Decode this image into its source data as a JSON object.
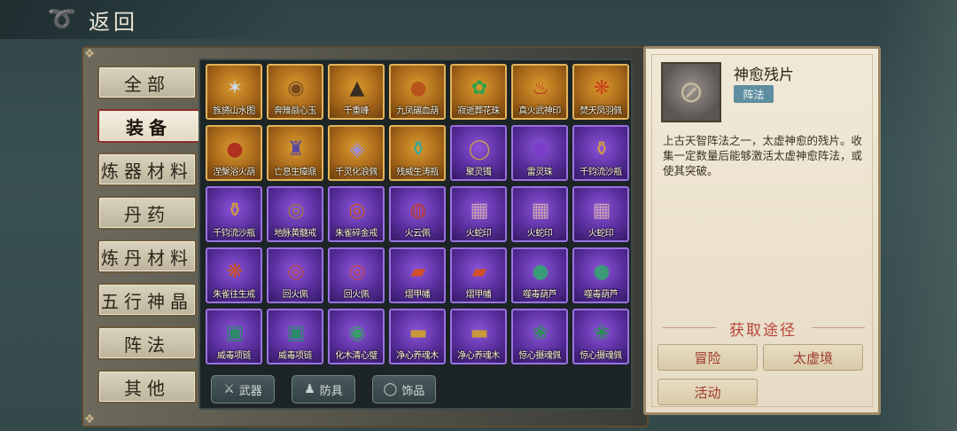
{
  "header": {
    "back_label": "返回"
  },
  "categories": [
    {
      "label": "全部",
      "active": false
    },
    {
      "label": "装备",
      "active": true
    },
    {
      "label": "炼器材料",
      "active": false
    },
    {
      "label": "丹药",
      "active": false
    },
    {
      "label": "炼丹材料",
      "active": false
    },
    {
      "label": "五行神晶",
      "active": false
    },
    {
      "label": "阵法",
      "active": false
    },
    {
      "label": "其他",
      "active": false
    }
  ],
  "items": [
    {
      "name": "旌旖山水图",
      "rarity": "gold",
      "glyph": "✶",
      "color": "#cfd8e4"
    },
    {
      "name": "奔雉赑心玉",
      "rarity": "gold",
      "glyph": "◉",
      "color": "#7a4a1e"
    },
    {
      "name": "千重峰",
      "rarity": "gold",
      "glyph": "▲",
      "color": "#3a2e22"
    },
    {
      "name": "九凤碾血葫",
      "rarity": "gold",
      "glyph": "●",
      "color": "#b8541c"
    },
    {
      "name": "寂逝葬花珠",
      "rarity": "gold",
      "glyph": "✿",
      "color": "#2fa04a"
    },
    {
      "name": "真火武神印",
      "rarity": "gold",
      "glyph": "♨",
      "color": "#b52a1e"
    },
    {
      "name": "焚天凤羽佩",
      "rarity": "gold",
      "glyph": "❋",
      "color": "#c9421c"
    },
    {
      "name": "涅槃浴火葫",
      "rarity": "gold",
      "glyph": "●",
      "color": "#b0301e"
    },
    {
      "name": "亡息生瘴鼎",
      "rarity": "gold",
      "glyph": "♜",
      "color": "#5a4aa0"
    },
    {
      "name": "千灵化浪佩",
      "rarity": "gold",
      "glyph": "◈",
      "color": "#9d8ed6"
    },
    {
      "name": "残威生涛瓶",
      "rarity": "gold",
      "glyph": "⚱",
      "color": "#2ea6a0"
    },
    {
      "name": "聚灵镯",
      "rarity": "purple",
      "glyph": "◯",
      "color": "#c8a04a"
    },
    {
      "name": "雷灵珠",
      "rarity": "purple",
      "glyph": "●",
      "color": "#7a3ec8"
    },
    {
      "name": "千钧流沙瓶",
      "rarity": "purple",
      "glyph": "⚱",
      "color": "#d4a03a"
    },
    {
      "name": "千钧流沙瓶",
      "rarity": "purple",
      "glyph": "⚱",
      "color": "#d4a03a"
    },
    {
      "name": "地脉黄髓戒",
      "rarity": "purple",
      "glyph": "◎",
      "color": "#a07a3a"
    },
    {
      "name": "朱雀碎金戒",
      "rarity": "purple",
      "glyph": "◎",
      "color": "#c85a1e"
    },
    {
      "name": "火云佩",
      "rarity": "purple",
      "glyph": "◍",
      "color": "#b83a2a"
    },
    {
      "name": "火蛇印",
      "rarity": "purple",
      "glyph": "▦",
      "color": "#c8a0b4"
    },
    {
      "name": "火蛇印",
      "rarity": "purple",
      "glyph": "▦",
      "color": "#c8a0b4"
    },
    {
      "name": "火蛇印",
      "rarity": "purple",
      "glyph": "▦",
      "color": "#c8a0b4"
    },
    {
      "name": "朱雀往生戒",
      "rarity": "purple",
      "glyph": "❋",
      "color": "#c8501e"
    },
    {
      "name": "回火佩",
      "rarity": "purple",
      "glyph": "◎",
      "color": "#c04848"
    },
    {
      "name": "回火佩",
      "rarity": "purple",
      "glyph": "◎",
      "color": "#c04848"
    },
    {
      "name": "熠甲幡",
      "rarity": "purple",
      "glyph": "▰",
      "color": "#d0502a"
    },
    {
      "name": "熠甲幡",
      "rarity": "purple",
      "glyph": "▰",
      "color": "#d0502a"
    },
    {
      "name": "噬毒葫芦",
      "rarity": "purple",
      "glyph": "●",
      "color": "#3a9a7a"
    },
    {
      "name": "噬毒葫芦",
      "rarity": "purple",
      "glyph": "●",
      "color": "#3a9a7a"
    },
    {
      "name": "威毒项链",
      "rarity": "purple",
      "glyph": "▣",
      "color": "#2a8a6a"
    },
    {
      "name": "威毒项链",
      "rarity": "purple",
      "glyph": "▣",
      "color": "#2a8a6a"
    },
    {
      "name": "化木清心璧",
      "rarity": "purple",
      "glyph": "◉",
      "color": "#3a9a6a"
    },
    {
      "name": "净心养魂木",
      "rarity": "purple",
      "glyph": "▬",
      "color": "#c89a3a"
    },
    {
      "name": "净心养魂木",
      "rarity": "purple",
      "glyph": "▬",
      "color": "#c89a3a"
    },
    {
      "name": "惊心摄魂佩",
      "rarity": "purple",
      "glyph": "❀",
      "color": "#2e8a5a"
    },
    {
      "name": "惊心摄魂佩",
      "rarity": "purple",
      "glyph": "❀",
      "color": "#2e8a5a"
    }
  ],
  "filters": [
    {
      "label": "武器",
      "icon": "sword-icon",
      "glyph": "⚔"
    },
    {
      "label": "防具",
      "icon": "armor-icon",
      "glyph": "♟"
    },
    {
      "label": "饰品",
      "icon": "ring-icon",
      "glyph": "◯"
    }
  ],
  "detail": {
    "name": "神愈残片",
    "tag": "阵法",
    "description": "上古天智阵法之一，太虚神愈的残片。收集一定数量后能够激活太虚神愈阵法，或使其突破。",
    "source_title": "获取途径",
    "sources": [
      "冒险",
      "太虚境",
      "活动"
    ]
  },
  "colors": {
    "gold_frame": "#e2b45a",
    "purple_frame": "#9a72e0",
    "source_accent": "#b9463a",
    "tag_bg": "#5f8ea0"
  }
}
